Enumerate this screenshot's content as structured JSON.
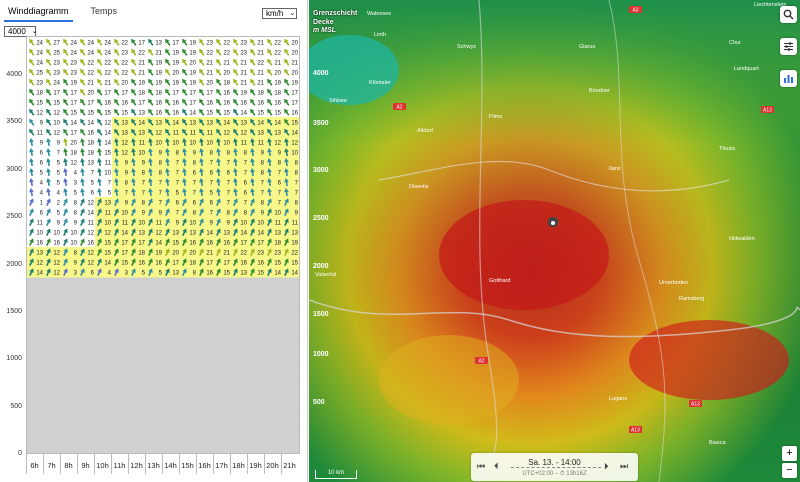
{
  "tabs": [
    {
      "label": "Winddiagramm",
      "active": true
    },
    {
      "label": "Temps",
      "active": false
    }
  ],
  "unit_select": {
    "value": "km/h"
  },
  "altitude_select": {
    "value": "4000"
  },
  "diagram": {
    "y_ticks": [
      "4000",
      "3500",
      "3000",
      "2500",
      "2000",
      "1500",
      "1000",
      "500",
      "0"
    ],
    "x_ticks": [
      "6h",
      "7h",
      "8h",
      "9h",
      "10h",
      "11h",
      "12h",
      "13h",
      "14h",
      "15h",
      "16h",
      "17h",
      "18h",
      "19h",
      "20h",
      "21h"
    ],
    "rows": [
      [
        24,
        27,
        24,
        24,
        24,
        22,
        17,
        13,
        17,
        19,
        23,
        22,
        23,
        21,
        22,
        20
      ],
      [
        24,
        25,
        24,
        24,
        24,
        23,
        22,
        21,
        19,
        19,
        22,
        22,
        23,
        21,
        22,
        20
      ],
      [
        24,
        23,
        23,
        22,
        22,
        22,
        21,
        19,
        19,
        20,
        21,
        21,
        21,
        22,
        21,
        21
      ],
      [
        25,
        23,
        23,
        22,
        22,
        22,
        21,
        19,
        20,
        19,
        21,
        20,
        21,
        21,
        20,
        20
      ],
      [
        23,
        24,
        19,
        21,
        21,
        20,
        19,
        19,
        19,
        19,
        20,
        18,
        21,
        21,
        19,
        19
      ],
      [
        18,
        17,
        17,
        20,
        17,
        17,
        18,
        18,
        17,
        17,
        17,
        16,
        19,
        18,
        18,
        17
      ],
      [
        15,
        15,
        17,
        17,
        16,
        16,
        17,
        16,
        16,
        17,
        16,
        16,
        16,
        16,
        16,
        17
      ],
      [
        12,
        12,
        15,
        15,
        15,
        15,
        13,
        16,
        16,
        14,
        15,
        15,
        14,
        15,
        15,
        16
      ],
      [
        9,
        10,
        14,
        14,
        12,
        13,
        14,
        13,
        14,
        13,
        13,
        14,
        13,
        14,
        14,
        15
      ],
      [
        11,
        12,
        17,
        16,
        14,
        13,
        13,
        12,
        11,
        11,
        11,
        12,
        12,
        13,
        13,
        14
      ],
      [
        9,
        9,
        20,
        18,
        14,
        12,
        11,
        10,
        10,
        10,
        10,
        10,
        11,
        11,
        12,
        12
      ],
      [
        6,
        7,
        18,
        18,
        15,
        12,
        10,
        9,
        8,
        9,
        8,
        8,
        8,
        9,
        9,
        10
      ],
      [
        6,
        5,
        12,
        13,
        11,
        9,
        9,
        8,
        7,
        8,
        7,
        7,
        7,
        8,
        8,
        8
      ],
      [
        5,
        5,
        4,
        7,
        10,
        9,
        8,
        8,
        7,
        6,
        6,
        6,
        7,
        8,
        7,
        8
      ],
      [
        4,
        5,
        3,
        5,
        7,
        8,
        7,
        7,
        7,
        7,
        7,
        7,
        6,
        7,
        6,
        7
      ],
      [
        4,
        4,
        5,
        6,
        5,
        7,
        7,
        7,
        5,
        7,
        5,
        7,
        6,
        7,
        7,
        7
      ],
      [
        1,
        2,
        8,
        12,
        13,
        9,
        8,
        7,
        6,
        6,
        6,
        7,
        7,
        8,
        7,
        8
      ],
      [
        6,
        5,
        8,
        14,
        11,
        10,
        9,
        9,
        7,
        8,
        7,
        8,
        8,
        9,
        10,
        9
      ],
      [
        11,
        9,
        9,
        11,
        10,
        11,
        10,
        11,
        9,
        10,
        9,
        9,
        10,
        10,
        11,
        11
      ],
      [
        10,
        10,
        10,
        12,
        12,
        14,
        13,
        12,
        13,
        13,
        14,
        13,
        14,
        14,
        13,
        13
      ],
      [
        16,
        16,
        10,
        16,
        15,
        17,
        17,
        14,
        15,
        16,
        16,
        16,
        17,
        17,
        18,
        19
      ],
      [
        13,
        12,
        8,
        12,
        15,
        17,
        18,
        19,
        20,
        20,
        21,
        21,
        22,
        23,
        23,
        22
      ],
      [
        12,
        12,
        9,
        12,
        14,
        15,
        16,
        16,
        17,
        18,
        17,
        17,
        16,
        16,
        15,
        15
      ],
      [
        14,
        12,
        3,
        6,
        4,
        3,
        5,
        5,
        13,
        8,
        16,
        15,
        13,
        15,
        14,
        14
      ]
    ]
  },
  "map": {
    "legend": [
      "Grenzschicht",
      "Decke",
      "m MSL"
    ],
    "contours": [
      "4000",
      "3500",
      "3000",
      "2500",
      "2000",
      "1500",
      "1000",
      "500"
    ],
    "roads": [
      "A2",
      "A2",
      "A13",
      "A13",
      "A13",
      "A3"
    ],
    "places": [
      "Walensee",
      "Linth",
      "Schwyz",
      "Glarus",
      "Klöntaler",
      "Sihlsee",
      "Chur",
      "Flims",
      "Bündner",
      "Altdorf",
      "Ilanz",
      "Disentis",
      "Thusis",
      "Ramsberg",
      "Valsertal",
      "Biasca",
      "Lugano",
      "Landquart",
      "Liechtenstein",
      "Nidwalden",
      "Urnerboden",
      "Gotthard"
    ],
    "time_label": "Sa. 13. - 14:00",
    "utc_label": "UTC+02:00 – ⏱ 13h16Z",
    "scale_label": "10 km"
  },
  "colors": {
    "accent": "#2f6fdf",
    "highlight": "#f7f78a"
  },
  "icons": [
    "search-icon",
    "sliders-icon",
    "chart-icon",
    "skip-back-icon",
    "step-back-icon",
    "step-forward-icon",
    "skip-forward-icon",
    "zoom-in-icon",
    "zoom-out-icon",
    "location-pin-icon"
  ]
}
